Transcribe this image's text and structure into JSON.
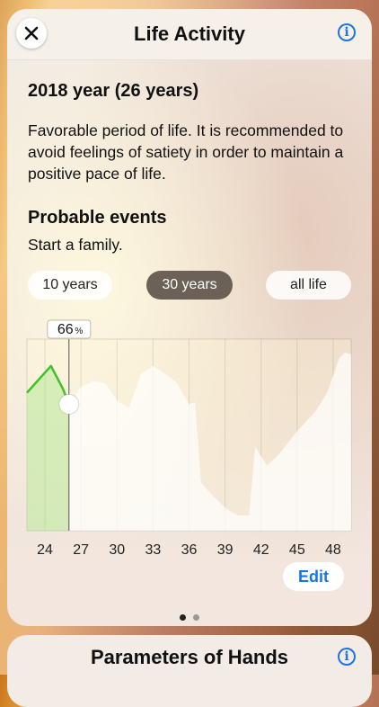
{
  "header": {
    "title": "Life Activity",
    "close_icon": "close-icon",
    "info_icon": "info-icon"
  },
  "summary": {
    "year_heading": "2018 year (26 years)",
    "description": "Favorable period of life. It is recommended to avoid feelings of satiety in order to maintain a positive pace of life.",
    "events_heading": "Probable events",
    "events_text": "Start a family."
  },
  "range_tabs": [
    {
      "label": "10 years",
      "selected": false
    },
    {
      "label": "30 years",
      "selected": true
    },
    {
      "label": "all life",
      "selected": false
    }
  ],
  "chart_data": {
    "type": "area",
    "x_ticks": [
      "24",
      "27",
      "30",
      "33",
      "36",
      "39",
      "42",
      "45",
      "48"
    ],
    "current": {
      "age": 26,
      "value": 66,
      "unit": "%"
    },
    "ylim": [
      0,
      100
    ],
    "xlim": [
      22.5,
      49.5
    ],
    "past_series": {
      "name": "",
      "color": "#3ec12c",
      "points": [
        [
          22.5,
          72
        ],
        [
          24.5,
          86
        ],
        [
          25.5,
          74
        ],
        [
          26,
          66
        ]
      ]
    },
    "future_series": {
      "name": "",
      "color": "#ffffff",
      "points": [
        [
          26,
          66
        ],
        [
          27,
          75
        ],
        [
          28,
          78
        ],
        [
          29,
          77
        ],
        [
          30,
          68
        ],
        [
          31,
          64
        ],
        [
          32,
          82
        ],
        [
          33,
          86
        ],
        [
          34,
          82
        ],
        [
          35,
          77
        ],
        [
          36,
          66
        ],
        [
          36.5,
          67
        ],
        [
          37,
          25
        ],
        [
          38,
          18
        ],
        [
          39,
          12
        ],
        [
          40,
          8
        ],
        [
          41,
          8
        ],
        [
          41.5,
          44
        ],
        [
          42.5,
          34
        ],
        [
          43.5,
          40
        ],
        [
          45,
          52
        ],
        [
          46.5,
          62
        ],
        [
          47.5,
          72
        ],
        [
          48.5,
          90
        ],
        [
          49,
          93
        ],
        [
          49.5,
          92
        ]
      ]
    },
    "grid": true
  },
  "edit_label": "Edit",
  "pagination": {
    "count": 2,
    "active": 0
  },
  "next_card": {
    "title": "Parameters of Hands"
  }
}
